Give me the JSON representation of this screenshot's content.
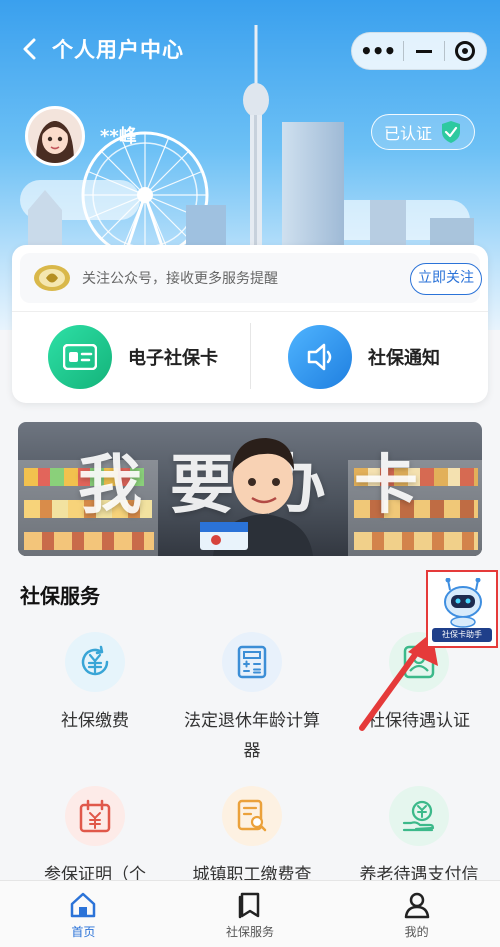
{
  "nav": {
    "title": "个人用户中心",
    "more_icon": "•••"
  },
  "user": {
    "name": "**峰",
    "verified_label": "已认证"
  },
  "follow": {
    "text": "关注公众号，接收更多服务提醒",
    "button": "立即关注"
  },
  "quick_actions": [
    {
      "label": "电子社保卡",
      "icon": "id-card-icon",
      "color": "#1fc58c"
    },
    {
      "label": "社保通知",
      "icon": "speaker-icon",
      "color": "#2e8df0"
    }
  ],
  "banner": {
    "text": "我要办卡"
  },
  "services": {
    "title": "社保服务",
    "items": [
      {
        "label": "社保缴费",
        "icon": "yuan-refresh-icon"
      },
      {
        "label": "法定退休年龄计算器",
        "icon": "calculator-icon"
      },
      {
        "label": "社保待遇认证",
        "icon": "person-badge-icon"
      },
      {
        "label": "参保证明（个",
        "icon": "calendar-yuan-icon"
      },
      {
        "label": "城镇职工缴费查",
        "icon": "document-search-icon"
      },
      {
        "label": "养老待遇支付信",
        "icon": "hand-yuan-icon"
      }
    ]
  },
  "assistant": {
    "label": "社保卡助手"
  },
  "tabbar": [
    {
      "label": "首页",
      "icon": "home-icon",
      "active": true
    },
    {
      "label": "社保服务",
      "icon": "book-icon",
      "active": false
    },
    {
      "label": "我的",
      "icon": "person-icon",
      "active": false
    }
  ],
  "colors": {
    "accent": "#2b73d8",
    "green": "#1fc58c",
    "red_annotation": "#e53a3a"
  }
}
